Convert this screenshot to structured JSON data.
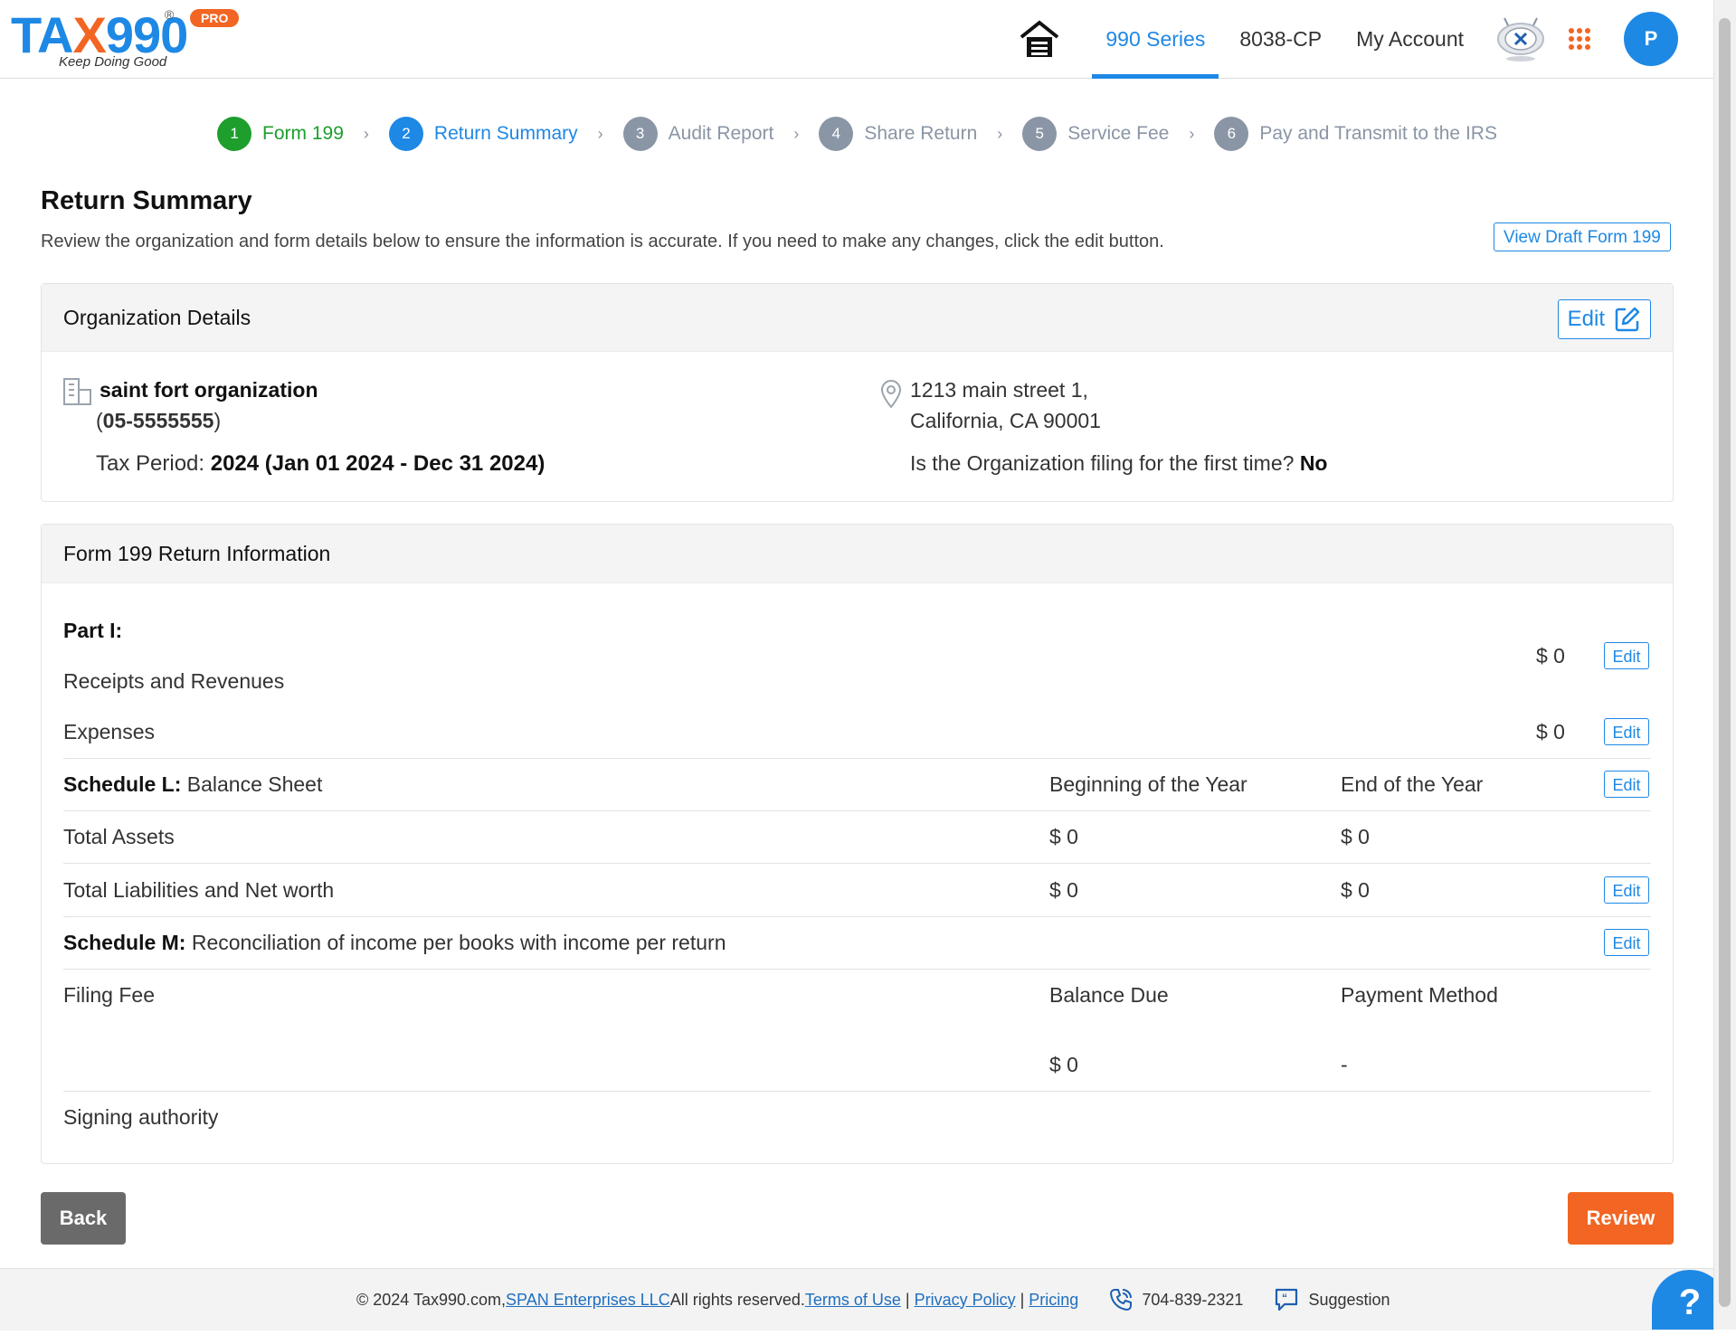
{
  "brand": {
    "logo_text_a": "TA",
    "logo_text_x": "X",
    "logo_text_b": "990",
    "registered": "®",
    "badge": "PRO",
    "tagline": "Keep Doing Good"
  },
  "nav": {
    "items": [
      "990 Series",
      "8038-CP",
      "My Account"
    ],
    "avatar_initial": "P"
  },
  "stepper": [
    {
      "num": "1",
      "label": "Form 199",
      "state": "done"
    },
    {
      "num": "2",
      "label": "Return Summary",
      "state": "current"
    },
    {
      "num": "3",
      "label": "Audit Report",
      "state": "upcoming"
    },
    {
      "num": "4",
      "label": "Share Return",
      "state": "upcoming"
    },
    {
      "num": "5",
      "label": "Service Fee",
      "state": "upcoming"
    },
    {
      "num": "6",
      "label": "Pay and Transmit to the IRS",
      "state": "upcoming"
    }
  ],
  "page": {
    "title": "Return Summary",
    "description": "Review the organization and form details below to ensure the information is accurate. If you need to make any changes, click the edit button.",
    "view_draft": "View Draft Form 199"
  },
  "org": {
    "header": "Organization Details",
    "edit": "Edit",
    "name": "saint fort organization",
    "ein_open": "(",
    "ein": "05-5555555",
    "ein_close": ")",
    "tax_period_label": "Tax Period: ",
    "tax_period_value": "2024 (Jan 01 2024 - Dec 31 2024)",
    "address_line1": "1213 main street 1,",
    "address_line2": "California, CA 90001",
    "first_time_q": "Is the Organization filing for the first time? ",
    "first_time_a": "No"
  },
  "ret": {
    "header": "Form 199 Return Information",
    "edit": "Edit",
    "part1": "Part I:",
    "receipts_label": "Receipts and Revenues",
    "receipts_value": "$ 0",
    "expenses_label": "Expenses",
    "expenses_value": "$ 0",
    "schedule_l": "Schedule L:",
    "schedule_l_title": " Balance Sheet",
    "col_begin": "Beginning of the Year",
    "col_end": "End of the Year",
    "total_assets": "Total Assets",
    "total_assets_begin": "$ 0",
    "total_assets_end": "$ 0",
    "total_liab": "Total Liabilities and Net worth",
    "total_liab_begin": "$ 0",
    "total_liab_end": "$ 0",
    "schedule_m": "Schedule M:",
    "schedule_m_title": " Reconciliation of income per books with income per return",
    "filing_fee": "Filing Fee",
    "balance_due": "Balance Due",
    "payment_method": "Payment Method",
    "balance_due_value": "$ 0",
    "payment_method_value": "-",
    "signing_authority": "Signing authority"
  },
  "actions": {
    "back": "Back",
    "review": "Review"
  },
  "footer": {
    "copyright": "© 2024 Tax990.com, ",
    "span": "SPAN Enterprises LLC",
    "rights": " All rights reserved. ",
    "terms": "Terms of Use",
    "privacy": "Privacy Policy",
    "pricing": "Pricing",
    "sep": "|",
    "phone": "704-839-2321",
    "suggestion": "Suggestion"
  },
  "help": "?",
  "colors": {
    "primary": "#1e88e5",
    "accent": "#f26522",
    "success": "#1d9e2d",
    "muted": "#8a95a5"
  }
}
